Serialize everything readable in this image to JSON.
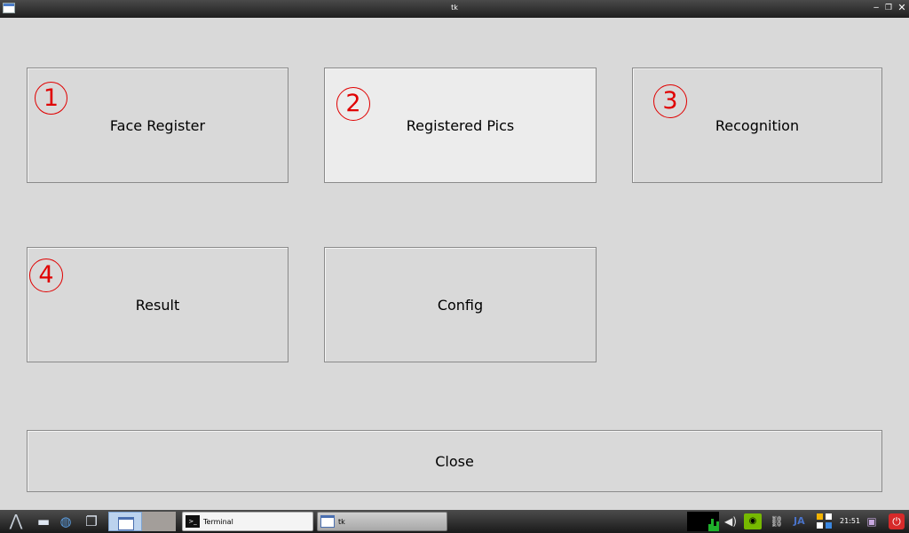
{
  "window": {
    "title": "tk",
    "minimize_glyph": "‒",
    "restore_glyph": "❐",
    "close_glyph": "✕"
  },
  "buttons": {
    "face_register": "Face Register",
    "registered_pics": "Registered Pics",
    "recognition": "Recognition",
    "result": "Result",
    "config": "Config",
    "close": "Close"
  },
  "annotations": {
    "mark_1": "1",
    "mark_2": "2",
    "mark_3": "3",
    "mark_4": "4",
    "color": "#e00000"
  },
  "taskbar": {
    "tasks": [
      {
        "label": "Terminal",
        "icon": "terminal-icon"
      },
      {
        "label": "tk",
        "icon": "window-icon"
      }
    ],
    "ime": "JA",
    "clock": "21:51",
    "icons": [
      "menu-icon",
      "folder-icon",
      "browser-icon",
      "windows-icon",
      "cpu-graph",
      "volume-icon",
      "nvidia-icon",
      "network-icon",
      "grid-icon",
      "lock-icon",
      "power-icon"
    ]
  },
  "colors": {
    "background": "#d9d9d9",
    "active_button": "#ececec",
    "cpu_graph": "#1fb02b"
  }
}
